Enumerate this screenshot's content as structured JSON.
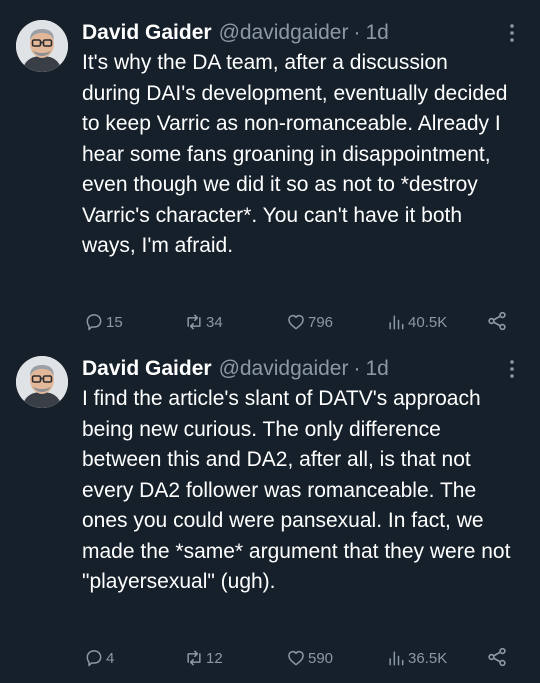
{
  "tweets": [
    {
      "display_name": "David Gaider",
      "handle": "@davidgaider",
      "separator": "·",
      "time": "1d",
      "text": "It's why the DA team, after a discussion during DAI's development, eventually decided to keep Varric as non-romanceable. Already I hear some fans groaning in disappointment, even though we did it so as not to *destroy Varric's character*. You can't have it both ways, I'm afraid.",
      "replies": "15",
      "reposts": "34",
      "likes": "796",
      "views": "40.5K"
    },
    {
      "display_name": "David Gaider",
      "handle": "@davidgaider",
      "separator": "·",
      "time": "1d",
      "text": "I find the article's slant of DATV's approach being new curious. The only difference between this and DA2, after all, is that not every DA2 follower was romanceable. The ones you could were pansexual. In fact, we made the *same* argument that they were not \"playersexual\" (ugh).",
      "replies": "4",
      "reposts": "12",
      "likes": "590",
      "views": "36.5K"
    }
  ],
  "icons": {
    "avatar": "avatar-photo",
    "more": "more-dots-icon",
    "reply": "reply-icon",
    "repost": "repost-icon",
    "like": "heart-icon",
    "views": "views-chart-icon",
    "share": "share-icon"
  },
  "colors": {
    "background": "#15202b",
    "primary_text": "#ffffff",
    "secondary_text": "#8b98a5"
  }
}
